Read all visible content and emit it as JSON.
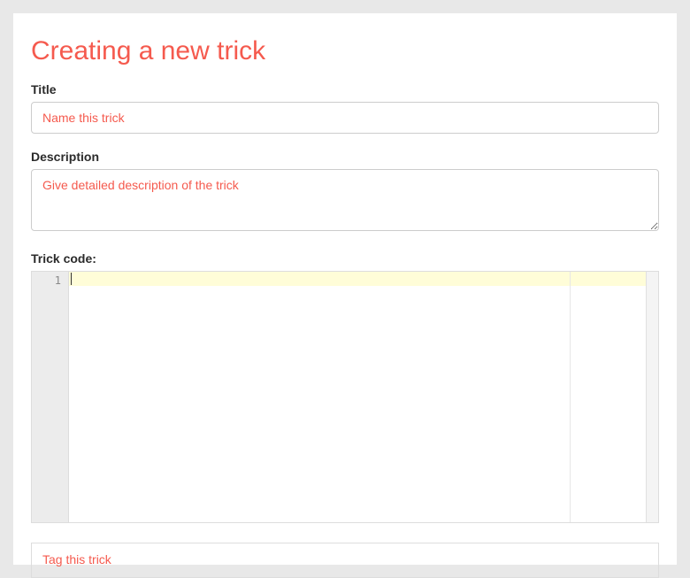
{
  "page": {
    "title": "Creating a new trick"
  },
  "fields": {
    "title": {
      "label": "Title",
      "placeholder": "Name this trick",
      "value": ""
    },
    "description": {
      "label": "Description",
      "placeholder": "Give detailed description of the trick",
      "value": ""
    },
    "code": {
      "label": "Trick code:",
      "line_number": "1",
      "value": ""
    },
    "tags": {
      "placeholder": "Tag  this trick",
      "value": ""
    }
  }
}
